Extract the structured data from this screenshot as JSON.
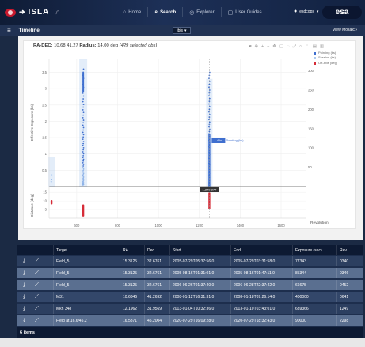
{
  "app": {
    "name": "ISLA",
    "user": "esdcops",
    "agency": "esa"
  },
  "nav": [
    {
      "icon": "home-icon",
      "label": "Home",
      "active": false
    },
    {
      "icon": "search-icon",
      "label": "Search",
      "active": true
    },
    {
      "icon": "explorer-icon",
      "label": "Explorer",
      "active": false
    },
    {
      "icon": "guides-icon",
      "label": "User Guides",
      "active": false
    }
  ],
  "timeline": {
    "title": "Timeline",
    "selector": "ibis",
    "mosaic": "View Mosaic"
  },
  "chart_info": {
    "radec_label": "RA-DEC:",
    "radec_value": "10.68 41.27",
    "radius_label": "Radius:",
    "radius_value": "14.00 deg",
    "selected": "(429 selected obs)"
  },
  "legend": [
    {
      "label": "Pointing (ks)",
      "color": "#3f6fcf"
    },
    {
      "label": "Session (ks)",
      "color": "#aecbef"
    },
    {
      "label": "Off-axis (deg)",
      "color": "#d62c38"
    }
  ],
  "chart_data": {
    "type": "scatter",
    "xlabel": "Revolution",
    "ylabel_left": "Effective Exposure (ks)",
    "ylabel_right": "",
    "ylabel_lower": "Distance (deg)",
    "x_ticks": [
      600,
      800,
      1000,
      1200,
      1400,
      1600
    ],
    "y_left_ticks": [
      0.5,
      1,
      1.5,
      2,
      2.5,
      3,
      3.5
    ],
    "y_right_ticks": [
      50,
      100,
      150,
      200,
      250,
      300
    ],
    "y_lower_ticks": [
      5,
      10,
      15
    ],
    "xlim": [
      465,
      1720
    ],
    "ylim_left": [
      0,
      3.9
    ],
    "ylim_right": [
      0,
      330
    ],
    "ylim_lower": [
      0,
      16
    ],
    "tooltip_point": "Pointing (ks)",
    "tooltip_value": "1.4 ks",
    "crosshair_x": "1,249.277",
    "series": [
      {
        "name": "Pointing (ks)",
        "groups": [
          {
            "x": 477,
            "y_min": 0.15,
            "y_max": 0.35
          },
          {
            "x": 632,
            "y_min": 0.05,
            "y_max": 3.6
          },
          {
            "x": 1249,
            "y_min": 0.05,
            "y_max": 3.5
          }
        ]
      },
      {
        "name": "Session (ks)",
        "groups": [
          {
            "x": 477,
            "ylim": 0.9
          },
          {
            "x": 632,
            "ylim": 3.9
          },
          {
            "x": 1249,
            "ylim": 3.3
          }
        ]
      },
      {
        "name": "Off-axis (deg)",
        "groups": [
          {
            "x": 477,
            "y_min": 8,
            "y_max": 10.5
          },
          {
            "x": 632,
            "y_min": 1,
            "y_max": 8
          },
          {
            "x": 1249,
            "y_min": 5,
            "y_max": 15
          }
        ]
      }
    ]
  },
  "table": {
    "columns": [
      "Target",
      "RA",
      "Dec",
      "Start",
      "End",
      "Exposure (sec)",
      "Rev"
    ],
    "rows": [
      {
        "target": "Field_5",
        "ra": "15.3125",
        "dec": "32.6761",
        "start": "2005-07-29T05:37:56.0",
        "end": "2005-07-29T03:31:58.0",
        "exposure": "77343",
        "rev": "0340"
      },
      {
        "target": "Field_5",
        "ra": "15.3125",
        "dec": "32.6761",
        "start": "2005-08-16T01:31:01.0",
        "end": "2005-08-16T01:47:11.0",
        "exposure": "85344",
        "rev": "0346"
      },
      {
        "target": "Field_5",
        "ra": "15.3125",
        "dec": "32.6761",
        "start": "2006-06-26T01:37:40.0",
        "end": "2006-06-28T22:37:42.0",
        "exposure": "66675",
        "rev": "0452"
      },
      {
        "target": "M31",
        "ra": "10.6846",
        "dec": "41.2692",
        "start": "2008-01-12T16:31:31.0",
        "end": "2008-01-18T09:26:14.0",
        "exposure": "400000",
        "rev": "0641"
      },
      {
        "target": "Mkn 348",
        "ra": "12.1962",
        "dec": "31.9569",
        "start": "2013-01-04T10:32:36.0",
        "end": "2013-01-10T03:43:01.0",
        "exposure": "639366",
        "rev": "1249"
      },
      {
        "target": "Field at 16.6/45.2",
        "ra": "16.5871",
        "dec": "45.2004",
        "start": "2020-07-29T16:09:28.0",
        "end": "2020-07-29T18:32:43.0",
        "exposure": "90000",
        "rev": "2298"
      }
    ],
    "count": "6 items"
  }
}
